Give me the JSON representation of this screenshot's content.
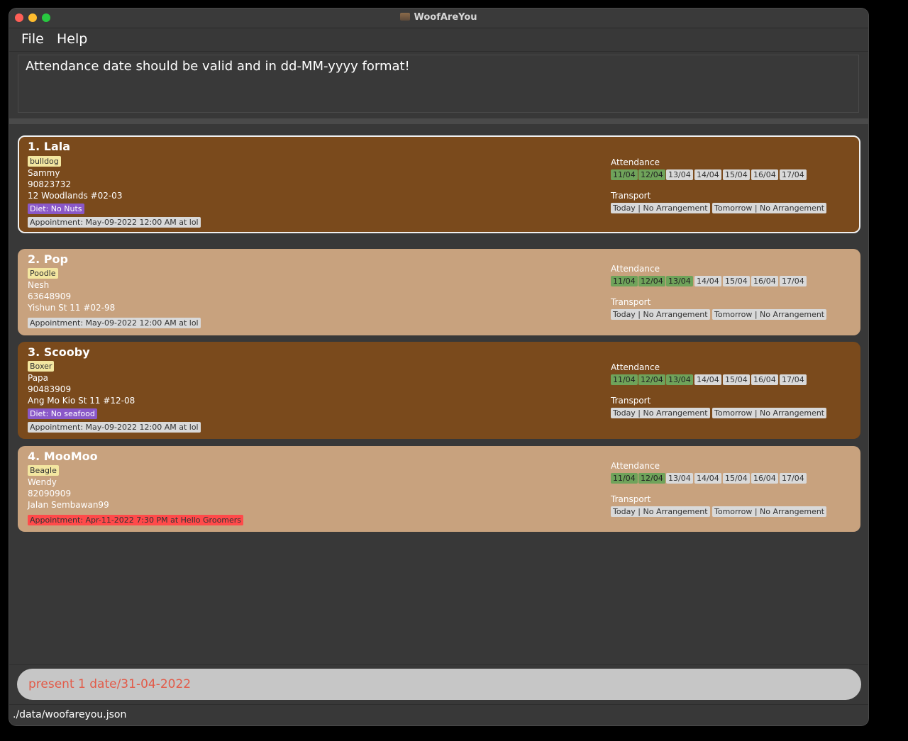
{
  "window": {
    "title": "WoofAreYou"
  },
  "menu": {
    "file": "File",
    "help": "Help"
  },
  "result": "Attendance date should be valid and in dd-MM-yyyy format!",
  "labels": {
    "attendance": "Attendance",
    "transport": "Transport"
  },
  "pets": [
    {
      "name": "1.  Lala",
      "breed": "bulldog",
      "owner": "Sammy",
      "phone": "90823732",
      "address": "12 Woodlands #02-03",
      "diet": "Diet: No Nuts",
      "appointment": "Appointment: May-09-2022 12:00 AM at lol",
      "attendance": [
        "11/04",
        "12/04",
        "13/04",
        "14/04",
        "15/04",
        "16/04",
        "17/04"
      ],
      "transport": [
        "Today | No Arrangement",
        "Tomorrow | No Arrangement"
      ]
    },
    {
      "name": "2.  Pop",
      "breed": "Poodle",
      "owner": "Nesh",
      "phone": "63648909",
      "address": "Yishun St 11 #02-98",
      "appointment": "Appointment: May-09-2022 12:00 AM at lol",
      "attendance": [
        "11/04",
        "12/04",
        "13/04",
        "14/04",
        "15/04",
        "16/04",
        "17/04"
      ],
      "transport": [
        "Today | No Arrangement",
        "Tomorrow | No Arrangement"
      ]
    },
    {
      "name": "3.  Scooby",
      "breed": "Boxer",
      "owner": "Papa",
      "phone": "90483909",
      "address": "Ang Mo Kio St 11 #12-08",
      "diet": "Diet: No seafood",
      "appointment": "Appointment: May-09-2022 12:00 AM at lol",
      "attendance": [
        "11/04",
        "12/04",
        "13/04",
        "14/04",
        "15/04",
        "16/04",
        "17/04"
      ],
      "transport": [
        "Today | No Arrangement",
        "Tomorrow | No Arrangement"
      ]
    },
    {
      "name": "4.  MooMoo",
      "breed": "Beagle",
      "owner": "Wendy",
      "phone": "82090909",
      "address": "Jalan Sembawan99",
      "appointment": "Appointment: Apr-11-2022 7:30 PM at Hello Groomers",
      "attendance": [
        "11/04",
        "12/04",
        "13/04",
        "14/04",
        "15/04",
        "16/04",
        "17/04"
      ],
      "transport": [
        "Today | No Arrangement",
        "Tomorrow | No Arrangement"
      ]
    }
  ],
  "command": {
    "value": "present 1 date/31-04-2022"
  },
  "status": "./data/woofareyou.json",
  "colors": {
    "present": "#6fa35a",
    "absent": "#d9d9d9",
    "card_dark": "#7a4a1c",
    "card_light": "#c8a27e",
    "overdue_appointment": "#ff4a4a"
  }
}
